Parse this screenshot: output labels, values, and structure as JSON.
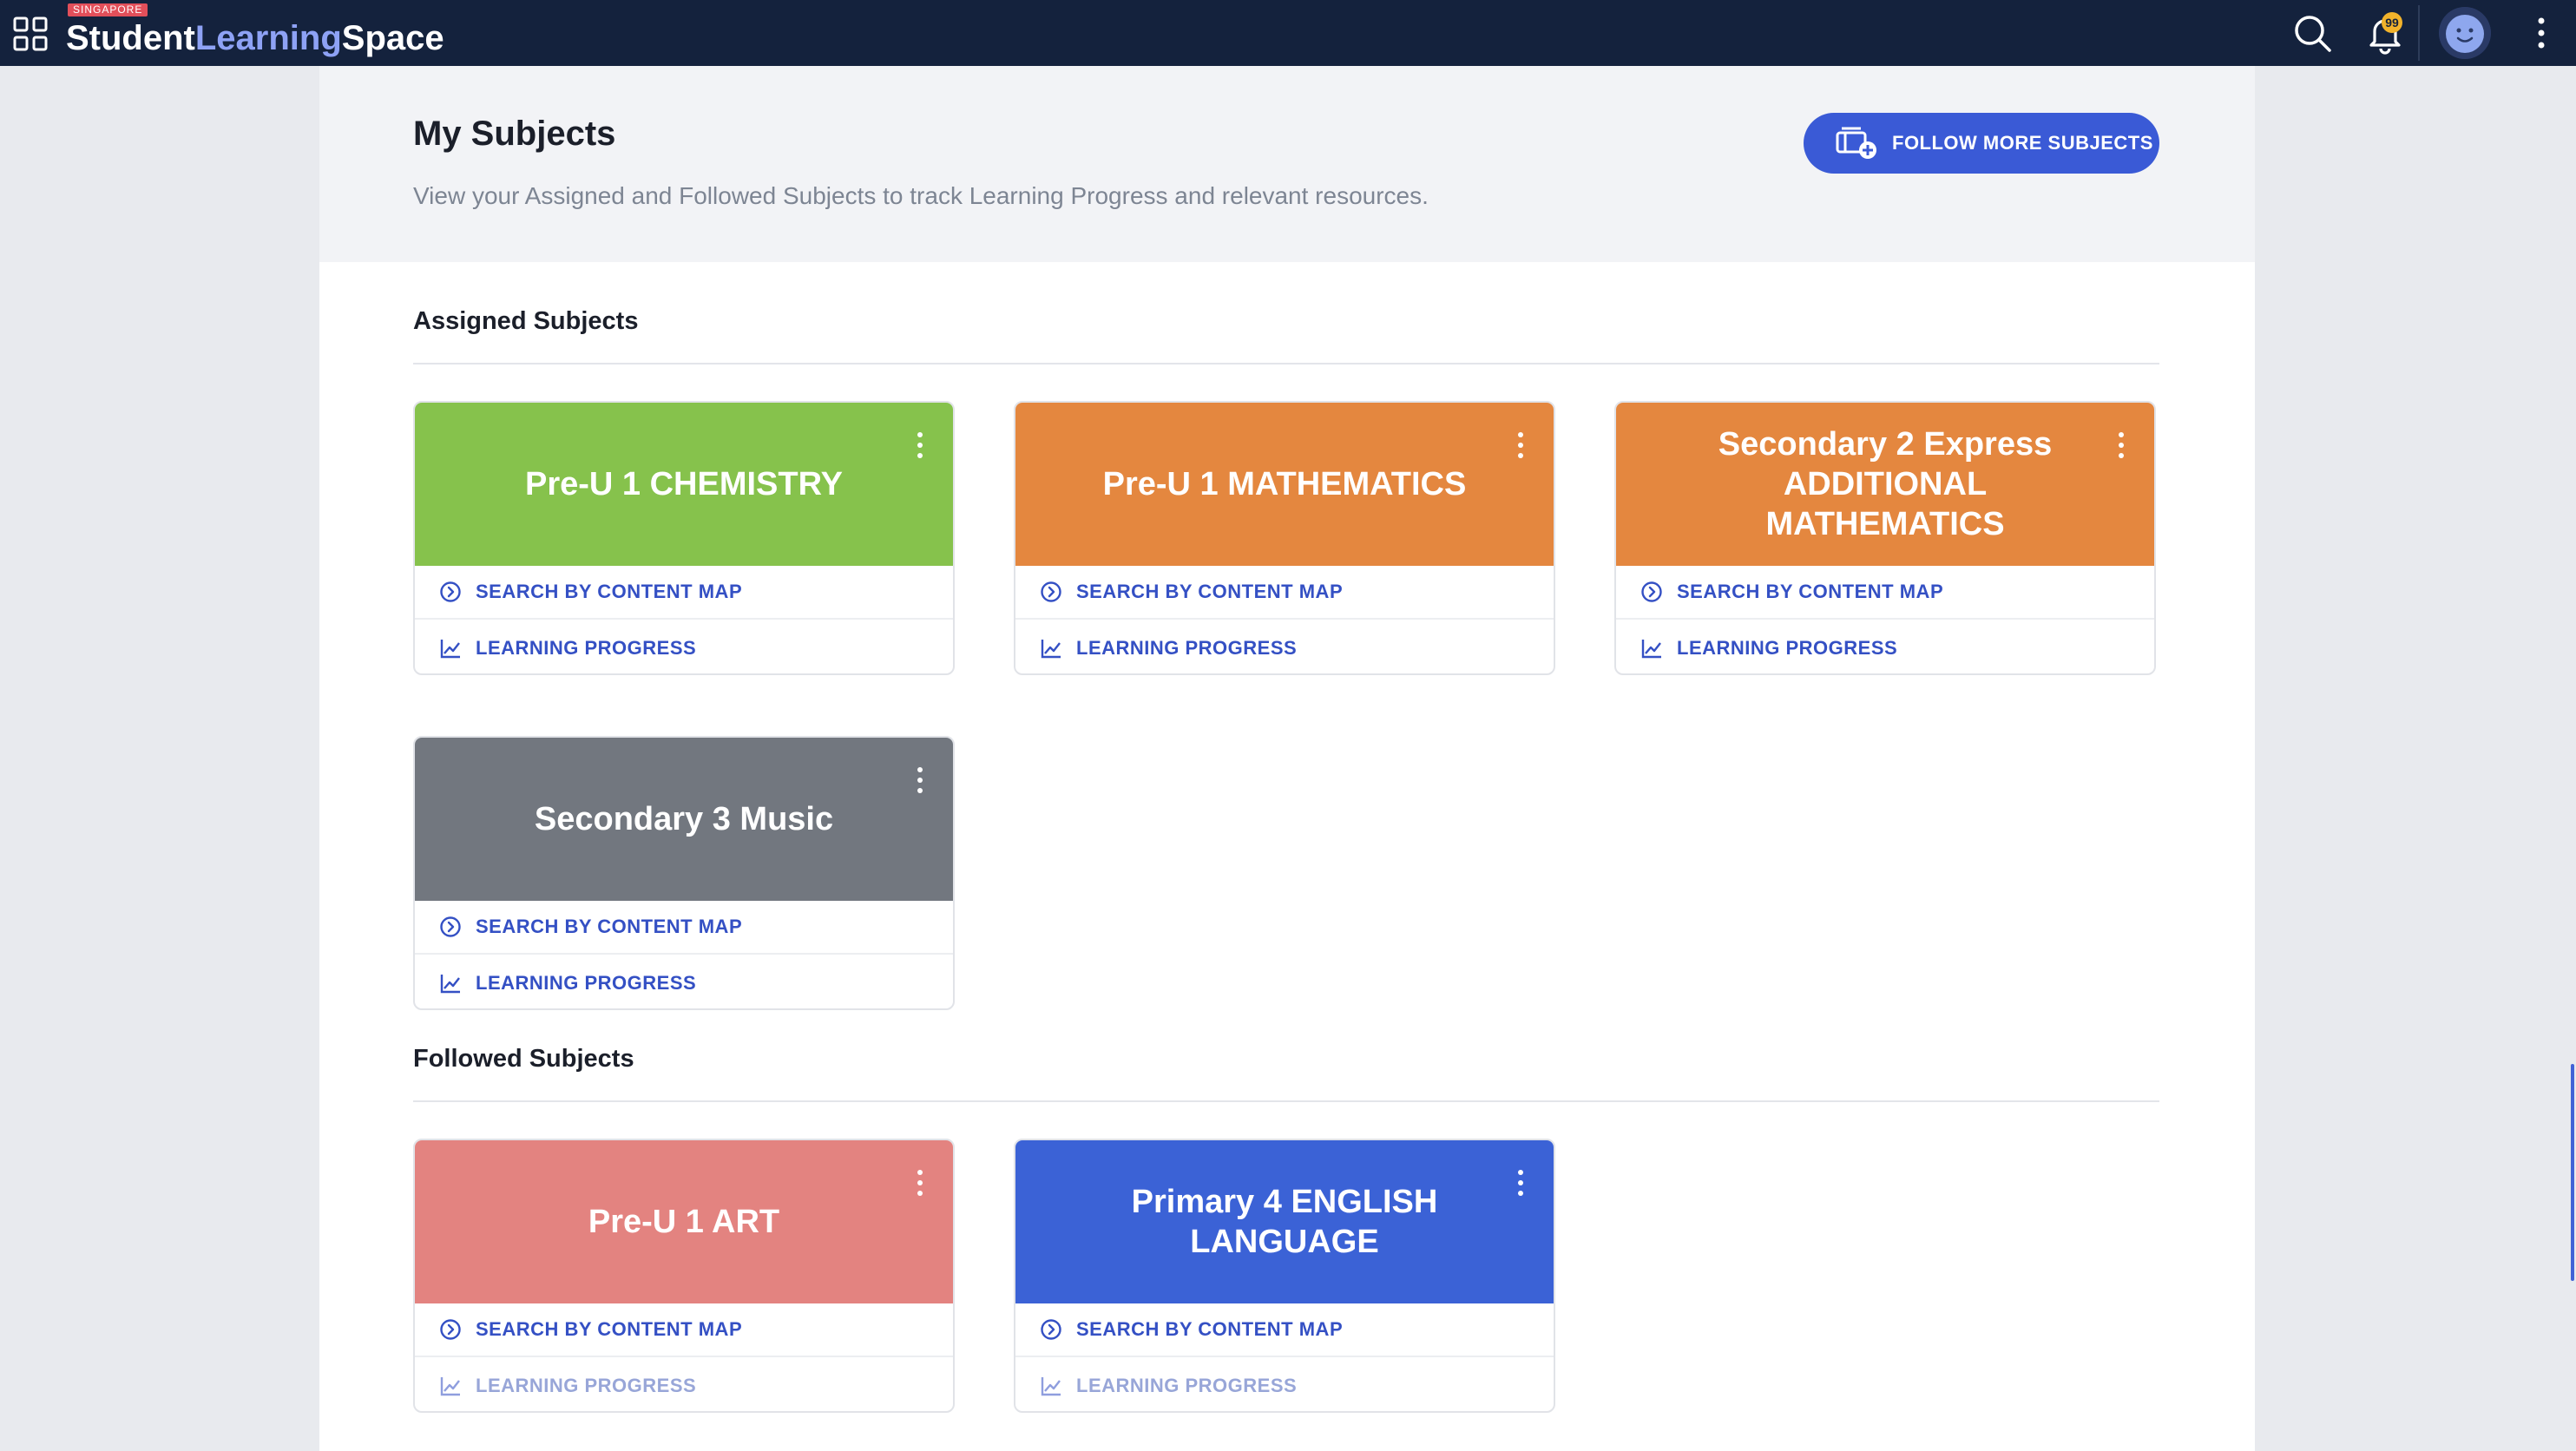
{
  "topbar": {
    "brand_tag": "SINGAPORE",
    "brand_word1": "Student",
    "brand_word2": "Learning",
    "brand_word3": "Space",
    "notification_count": "99",
    "icons": [
      "apps-grid-icon",
      "search-icon",
      "bell-icon",
      "avatar",
      "more-vertical-icon"
    ]
  },
  "header": {
    "title": "My Subjects",
    "subtitle": "View your Assigned and Followed Subjects to track Learning Progress and relevant resources.",
    "follow_button": "FOLLOW MORE SUBJECTS"
  },
  "labels": {
    "search": "SEARCH BY CONTENT MAP",
    "progress": "LEARNING PROGRESS"
  },
  "assigned": {
    "title": "Assigned Subjects",
    "cards": [
      {
        "name": "Pre-U 1 CHEMISTRY",
        "color": "#86c24c"
      },
      {
        "name": "Pre-U 1 MATHEMATICS",
        "color": "#e4873f"
      },
      {
        "name": "Secondary 2 Express ADDITIONAL MATHEMATICS",
        "color": "#e4873f"
      },
      {
        "name": "Secondary 3 Music",
        "color": "#72777f"
      }
    ]
  },
  "followed": {
    "title": "Followed Subjects",
    "cards": [
      {
        "name": "Pre-U 1 ART",
        "color": "#e38380"
      },
      {
        "name": "Primary 4 ENGLISH LANGUAGE",
        "color": "#3b62d6"
      }
    ]
  },
  "colors": {
    "topbar_bg": "#14223d",
    "accent_blue": "#3a5ad6",
    "link_blue": "#3450c4"
  }
}
